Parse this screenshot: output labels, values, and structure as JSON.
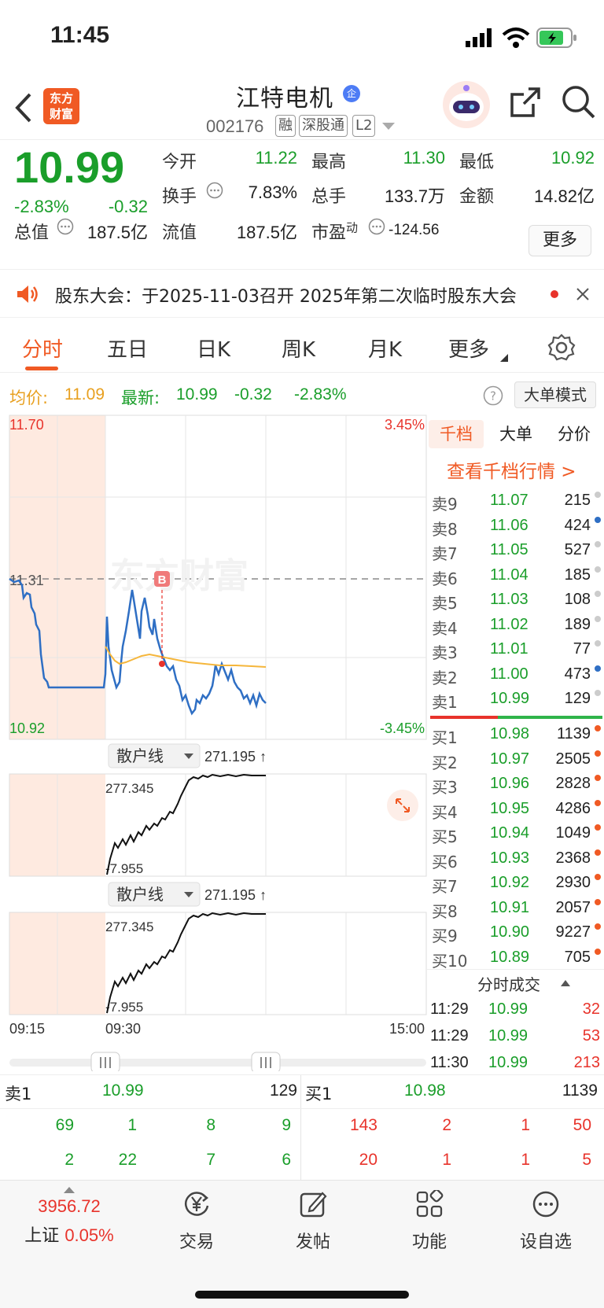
{
  "status_bar": {
    "time": "11:45"
  },
  "header": {
    "logo_text": "东方财富",
    "stock_name": "江特电机",
    "corp_badge": "企",
    "stock_code": "002176",
    "tags": [
      "融",
      "深股通",
      "L2"
    ]
  },
  "quote": {
    "price": "10.99",
    "change_pct": "-2.83%",
    "change": "-0.32",
    "open_label": "今开",
    "open": "11.22",
    "high_label": "最高",
    "high": "11.30",
    "low_label": "最低",
    "low": "10.92",
    "turnover_label": "换手",
    "turnover": "7.83%",
    "volume_label": "总手",
    "volume": "133.7万",
    "amount_label": "金额",
    "amount": "14.82亿",
    "mktcap_label": "总值",
    "mktcap": "187.5亿",
    "float_label": "流值",
    "float": "187.5亿",
    "pe_label": "市盈",
    "pe_sup": "动",
    "pe": "-124.56",
    "more": "更多"
  },
  "notice": {
    "text": "股东大会：于2025-11-03召开 2025年第二次临时股东大会"
  },
  "tabs": [
    "分时",
    "五日",
    "日K",
    "周K",
    "月K",
    "更多"
  ],
  "info_line": {
    "avg_label": "均价:",
    "avg": "11.09",
    "latest_label": "最新:",
    "latest": "10.99",
    "change": "-0.32",
    "change_pct": "-2.83%",
    "big_order_mode": "大单模式"
  },
  "chart": {
    "y_top": "11.70",
    "y_bottom": "10.92",
    "y_mid": "11.31",
    "pct_top": "3.45%",
    "pct_bottom": "-3.45%",
    "watermark": "东方财富",
    "buy_marker": "B",
    "sub_label": "散户线",
    "sub_value": "271.195 ↑",
    "sub_top": "277.345",
    "sub_bottom": "-7.955",
    "time_start": "09:15",
    "time_open": "09:30",
    "time_end": "15:00",
    "colors": {
      "price": "#2f6fc4",
      "avg": "#f5b63b",
      "pre_market": "#fde3d6"
    }
  },
  "book": {
    "tabs": [
      "千档",
      "大单",
      "分价"
    ],
    "link": "查看千档行情 >",
    "asks": [
      {
        "label": "卖9",
        "price": "11.07",
        "vol": "215",
        "dot": "#cccccc"
      },
      {
        "label": "卖8",
        "price": "11.06",
        "vol": "424",
        "dot": "#2f6fc4"
      },
      {
        "label": "卖7",
        "price": "11.05",
        "vol": "527",
        "dot": "#cccccc"
      },
      {
        "label": "卖6",
        "price": "11.04",
        "vol": "185",
        "dot": "#cccccc"
      },
      {
        "label": "卖5",
        "price": "11.03",
        "vol": "108",
        "dot": "#cccccc"
      },
      {
        "label": "卖4",
        "price": "11.02",
        "vol": "189",
        "dot": "#cccccc"
      },
      {
        "label": "卖3",
        "price": "11.01",
        "vol": "77",
        "dot": "#cccccc"
      },
      {
        "label": "卖2",
        "price": "11.00",
        "vol": "473",
        "dot": "#2f6fc4"
      },
      {
        "label": "卖1",
        "price": "10.99",
        "vol": "129",
        "dot": "#cccccc"
      }
    ],
    "bids": [
      {
        "label": "买1",
        "price": "10.98",
        "vol": "1139",
        "dot": "#f05a24"
      },
      {
        "label": "买2",
        "price": "10.97",
        "vol": "2505",
        "dot": "#f05a24"
      },
      {
        "label": "买3",
        "price": "10.96",
        "vol": "2828",
        "dot": "#f05a24"
      },
      {
        "label": "买4",
        "price": "10.95",
        "vol": "4286",
        "dot": "#f05a24"
      },
      {
        "label": "买5",
        "price": "10.94",
        "vol": "1049",
        "dot": "#f05a24"
      },
      {
        "label": "买6",
        "price": "10.93",
        "vol": "2368",
        "dot": "#f05a24"
      },
      {
        "label": "买7",
        "price": "10.92",
        "vol": "2930",
        "dot": "#f05a24"
      },
      {
        "label": "买8",
        "price": "10.91",
        "vol": "2057",
        "dot": "#f05a24"
      },
      {
        "label": "买9",
        "price": "10.90",
        "vol": "9227",
        "dot": "#f05a24"
      },
      {
        "label": "买10",
        "price": "10.89",
        "vol": "705",
        "dot": "#f05a24"
      }
    ],
    "trades_title": "分时成交",
    "trades": [
      {
        "time": "11:29",
        "price": "10.99",
        "vol": "32"
      },
      {
        "time": "11:29",
        "price": "10.99",
        "vol": "53"
      },
      {
        "time": "11:30",
        "price": "10.99",
        "vol": "213"
      }
    ]
  },
  "summary": {
    "sell_label": "卖1",
    "sell_price": "10.99",
    "sell_vol": "129",
    "buy_label": "买1",
    "buy_price": "10.98",
    "buy_vol": "1139",
    "sell_row1": [
      "69",
      "1",
      "8",
      "9"
    ],
    "sell_row2": [
      "2",
      "22",
      "7",
      "6"
    ],
    "buy_row1": [
      "143",
      "2",
      "1",
      "50"
    ],
    "buy_row2": [
      "20",
      "1",
      "1",
      "5"
    ]
  },
  "nav": {
    "index_value": "3956.72",
    "index_name": "上证",
    "index_pct": "0.05%",
    "items": [
      "交易",
      "发帖",
      "功能",
      "设自选"
    ]
  }
}
